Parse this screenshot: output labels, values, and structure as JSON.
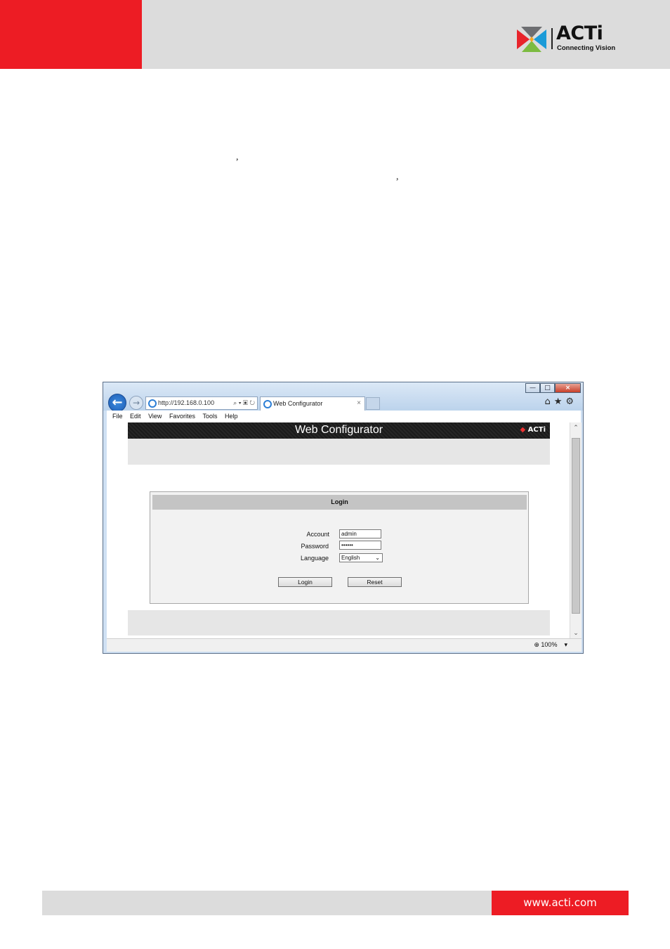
{
  "header": {
    "logo": {
      "name": "ACTi",
      "tagline": "Connecting Vision"
    }
  },
  "browser": {
    "address": "http://192.168.0.100",
    "tab_title": "Web Configurator",
    "tab_close": "×",
    "window_buttons": {
      "minimize": "—",
      "maximize": "□",
      "close": "×"
    },
    "menu": [
      "File",
      "Edit",
      "View",
      "Favorites",
      "Tools",
      "Help"
    ],
    "zoom": "100%"
  },
  "web_configurator": {
    "title": "Web Configurator",
    "logo": "ACTi",
    "login": {
      "heading": "Login",
      "account_label": "Account",
      "account_value": "admin",
      "password_label": "Password",
      "password_value": "••••••",
      "language_label": "Language",
      "language_value": "English",
      "login_button": "Login",
      "reset_button": "Reset"
    }
  },
  "footer": {
    "url": "www.acti.com"
  },
  "colors": {
    "brand_red": "#ed1c24",
    "band_gray": "#dcdcdc"
  }
}
